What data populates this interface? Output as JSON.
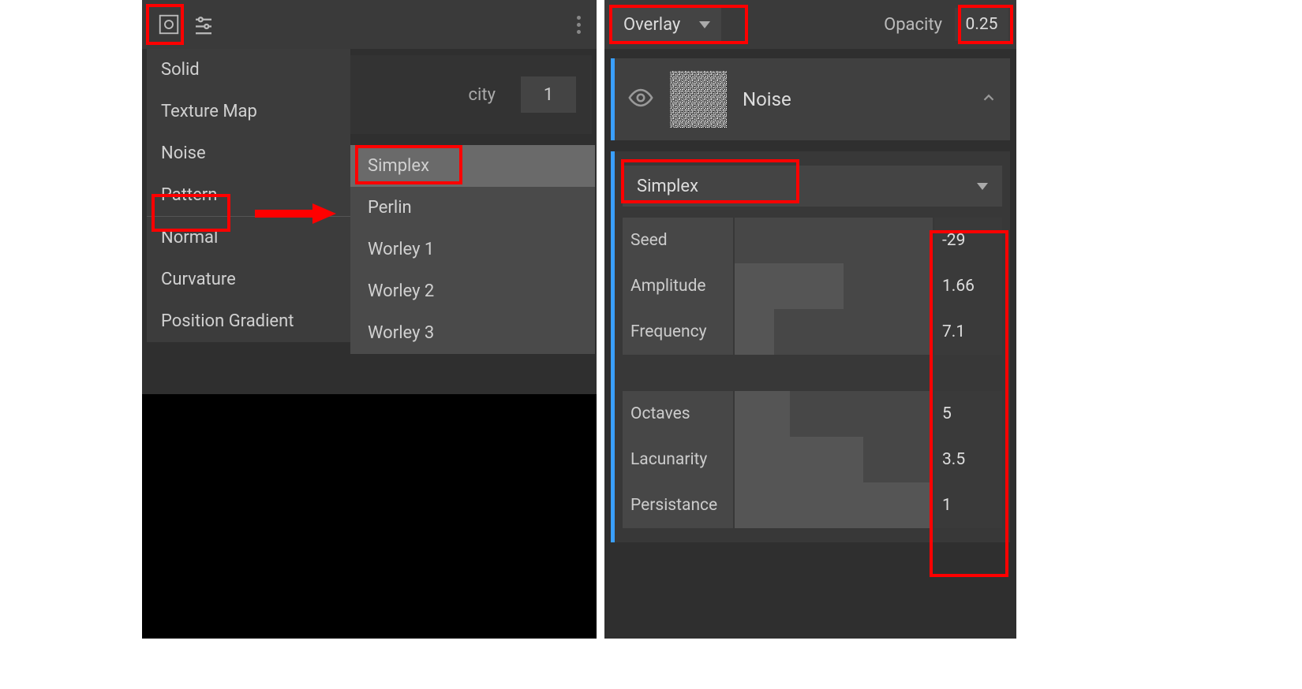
{
  "left": {
    "menu": {
      "items": [
        "Solid",
        "Texture Map",
        "Noise",
        "Pattern",
        "Normal",
        "Curvature",
        "Position Gradient"
      ]
    },
    "submenu": {
      "items": [
        "Simplex",
        "Perlin",
        "Worley 1",
        "Worley 2",
        "Worley 3"
      ]
    },
    "bg_opacity_fragment": "city",
    "bg_opacity_value": "1"
  },
  "right": {
    "blend_mode": "Overlay",
    "opacity_label": "Opacity",
    "opacity_value": "0.25",
    "layer_name": "Noise",
    "noise_type": "Simplex",
    "props": [
      {
        "label": "Seed",
        "value": "-29",
        "fill": 0
      },
      {
        "label": "Amplitude",
        "value": "1.66",
        "fill": 55
      },
      {
        "label": "Frequency",
        "value": "7.1",
        "fill": 20
      }
    ],
    "props2": [
      {
        "label": "Octaves",
        "value": "5",
        "fill": 28
      },
      {
        "label": "Lacunarity",
        "value": "3.5",
        "fill": 65
      },
      {
        "label": "Persistance",
        "value": "1",
        "fill": 100
      }
    ]
  }
}
